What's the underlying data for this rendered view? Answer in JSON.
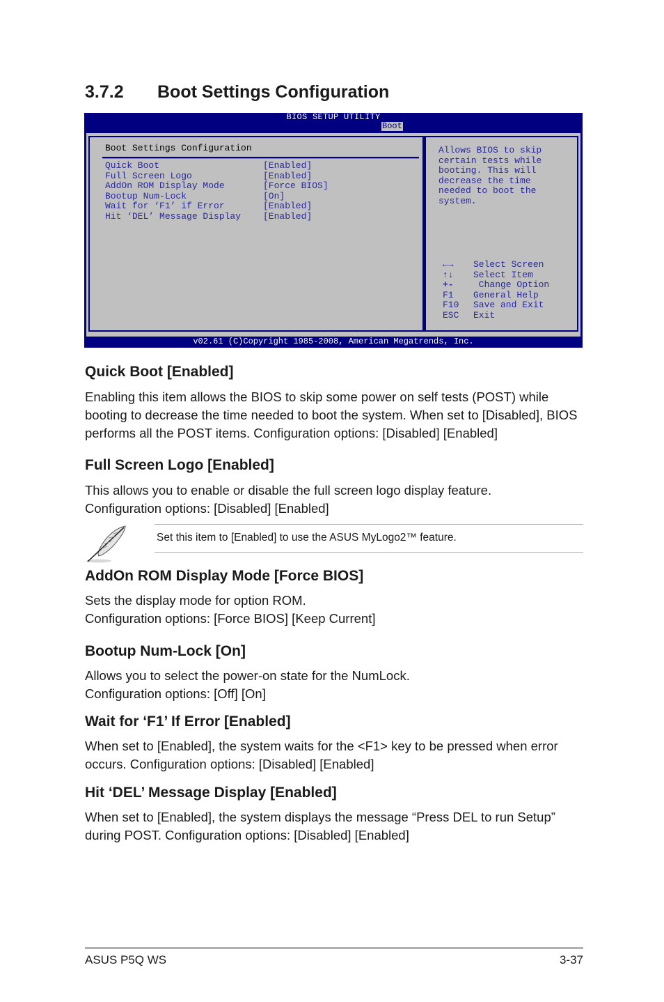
{
  "section": {
    "number": "3.7.2",
    "title": "Boot Settings Configuration"
  },
  "bios": {
    "utility_title": "BIOS SETUP UTILITY",
    "active_tab": "Boot",
    "panel_heading": "Boot Settings Configuration",
    "items": [
      {
        "label": "Quick Boot",
        "value": "[Enabled]"
      },
      {
        "label": "Full Screen Logo",
        "value": "[Enabled]"
      },
      {
        "label": "AddOn ROM Display Mode",
        "value": "[Force BIOS]"
      },
      {
        "label": "Bootup Num-Lock",
        "value": "[On]"
      },
      {
        "label": "Wait for ‘F1’ if Error",
        "value": "[Enabled]"
      },
      {
        "label": "Hit ‘DEL’ Message Display",
        "value": "[Enabled]"
      }
    ],
    "help_text": "Allows BIOS to skip\ncertain tests while\nbooting. This will\ndecrease the time\nneeded to boot the\nsystem.",
    "keys": [
      {
        "key": "←→",
        "action": "Select Screen"
      },
      {
        "key": "↑↓",
        "action": "Select Item"
      },
      {
        "key": "+-",
        "action": " Change Option"
      },
      {
        "key": "F1",
        "action": "General Help"
      },
      {
        "key": "F10",
        "action": "Save and Exit"
      },
      {
        "key": "ESC",
        "action": "Exit"
      }
    ],
    "footer": "v02.61 (C)Copyright 1985-2008, American Megatrends, Inc.",
    "colors": {
      "frame": "#000080",
      "panel": "#c0c0c0",
      "text": "#2828a0"
    }
  },
  "options": [
    {
      "heading": "Quick Boot [Enabled]",
      "body": "Enabling this item allows the BIOS to skip some power on self tests (POST) while booting to decrease the time needed to boot the system. When set to [Disabled], BIOS performs all the POST items. Configuration options: [Disabled] [Enabled]"
    },
    {
      "heading": "Full Screen Logo [Enabled]",
      "body": "This allows you to enable or disable the full screen logo display feature. Configuration options: [Disabled] [Enabled]"
    },
    {
      "heading": "AddOn ROM Display Mode [Force BIOS]",
      "body": "Sets the display mode for option ROM.\nConfiguration options: [Force BIOS] [Keep Current]"
    },
    {
      "heading": "Bootup Num-Lock [On]",
      "body": "Allows you to select the power-on state for the NumLock.\nConfiguration options: [Off] [On]"
    },
    {
      "heading": "Wait for ‘F1’ If Error [Enabled]",
      "body": "When set to [Enabled], the system waits for the <F1> key to be pressed when error occurs. Configuration options: [Disabled] [Enabled]"
    },
    {
      "heading": "Hit ‘DEL’ Message Display [Enabled]",
      "body": "When set to [Enabled], the system displays the message “Press DEL to run Setup” during POST. Configuration options: [Disabled] [Enabled]"
    }
  ],
  "note": {
    "icon": "feather-pen-icon",
    "text": "Set this item to [Enabled] to use the ASUS MyLogo2™ feature."
  },
  "page_footer": {
    "product": "ASUS P5Q WS",
    "page": "3-37"
  }
}
